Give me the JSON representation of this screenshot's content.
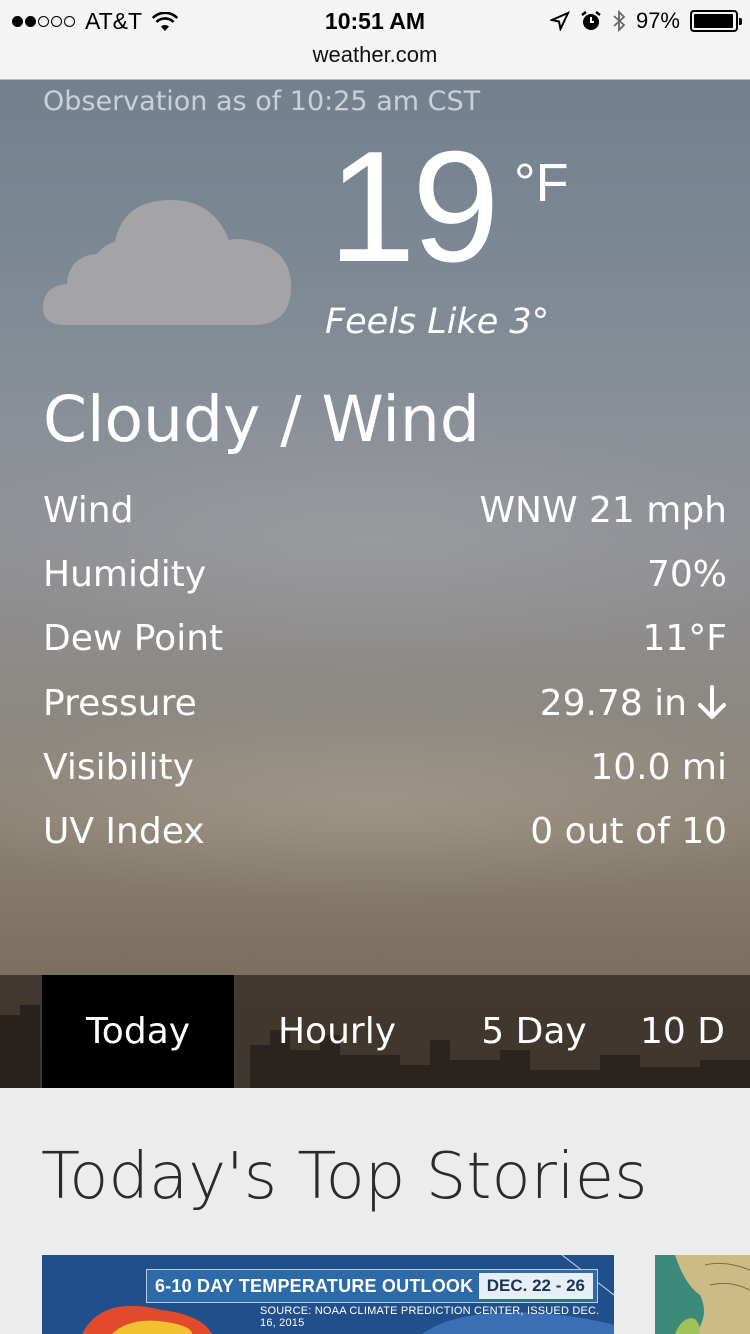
{
  "status_bar": {
    "carrier": "AT&T",
    "signal_bars_filled": 2,
    "signal_bars_total": 5,
    "time": "10:51 AM",
    "battery": "97%",
    "battery_level": 0.97,
    "url": "weather.com"
  },
  "observation": "Observation as of 10:25 am CST",
  "current": {
    "temperature": "19",
    "unit": "°F",
    "feels_like": "Feels Like 3°",
    "condition": "Cloudy / Wind",
    "icon": "cloud-icon"
  },
  "details": [
    {
      "label": "Wind",
      "value": "WNW 21 mph"
    },
    {
      "label": "Humidity",
      "value": "70%"
    },
    {
      "label": "Dew Point",
      "value": "11°F"
    },
    {
      "label": "Pressure",
      "value": "29.78 in"
    },
    {
      "label": "Visibility",
      "value": "10.0 mi"
    },
    {
      "label": "UV Index",
      "value": "0 out of 10"
    }
  ],
  "tabs": [
    {
      "label": "Today",
      "active": true
    },
    {
      "label": "Hourly",
      "active": false
    },
    {
      "label": "5 Day",
      "active": false
    },
    {
      "label": "10 D",
      "active": false
    }
  ],
  "top_stories": {
    "title": "Today's Top Stories",
    "card1": {
      "banner_title": "6-10 DAY TEMPERATURE OUTLOOK",
      "banner_date": "DEC. 22 - 26",
      "source": "SOURCE: NOAA CLIMATE PREDICTION CENTER, ISSUED DEC. 16, 2015"
    }
  },
  "colors": {
    "active_tab": "#000000",
    "tab_bar": "#342c26",
    "story_background": "#ececec"
  }
}
